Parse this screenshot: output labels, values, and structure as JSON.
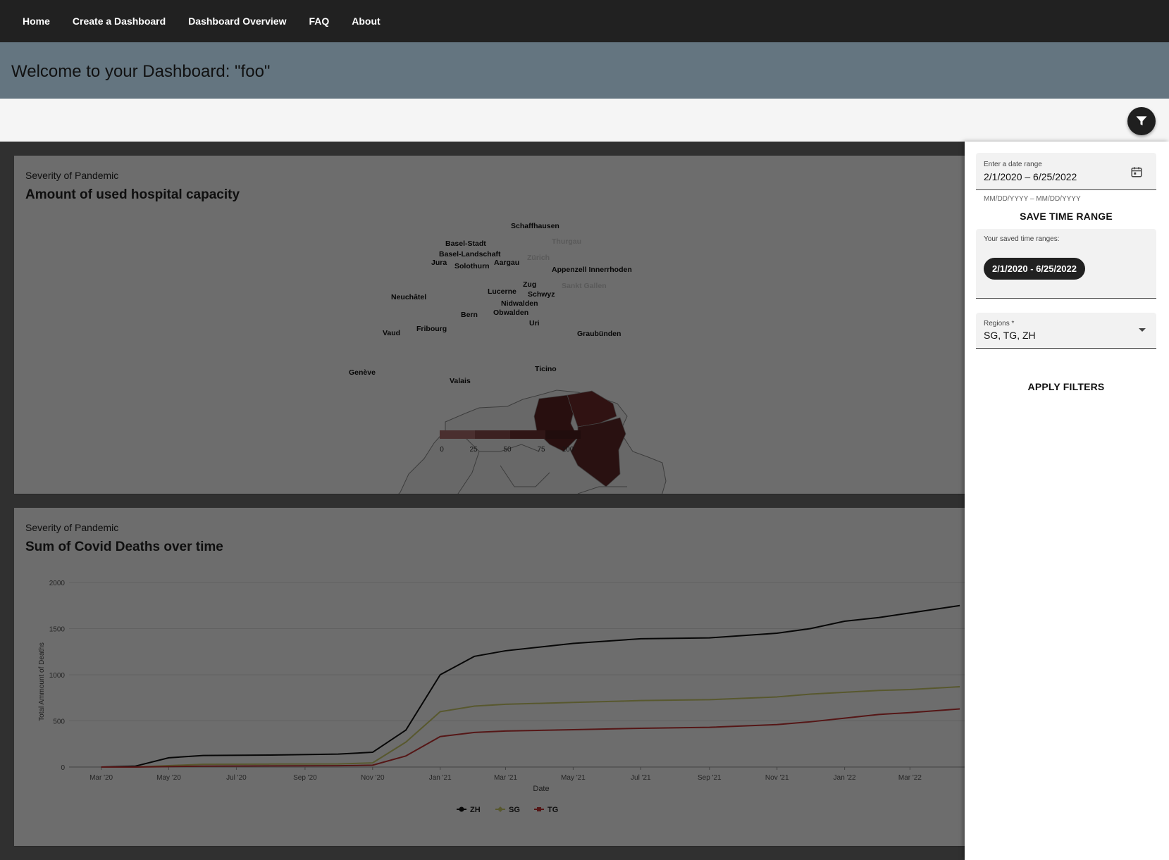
{
  "nav": {
    "items": [
      "Home",
      "Create a Dashboard",
      "Dashboard Overview",
      "FAQ",
      "About"
    ]
  },
  "header": {
    "title": "Welcome to your Dashboard: \"foo\""
  },
  "filter_button": {
    "icon": "filter-icon"
  },
  "map_card": {
    "subtitle": "Severity of Pandemic",
    "title": "Amount of used hospital capacity",
    "regions": [
      "Schaffhausen",
      "Thurgau",
      "Basel-Stadt",
      "Basel-Landschaft",
      "Jura",
      "Solothurn",
      "Aargau",
      "Zürich",
      "Appenzell Innerrhoden",
      "Neuchâtel",
      "Zug",
      "Lucerne",
      "Schwyz",
      "Sankt Gallen",
      "Nidwalden",
      "Obwalden",
      "Bern",
      "Uri",
      "Vaud",
      "Fribourg",
      "Graubünden",
      "Genève",
      "Ticino",
      "Valais"
    ],
    "highlighted_regions": [
      "Zürich",
      "Thurgau",
      "Sankt Gallen"
    ],
    "scale": {
      "ticks": [
        "0",
        "25",
        "50",
        "75",
        "100"
      ],
      "colors": [
        "#a86b6b",
        "#8a4b4b",
        "#6d3333",
        "#4c1f1f"
      ]
    }
  },
  "chart_card": {
    "subtitle": "Severity of Pandemic",
    "title": "Sum of Covid Deaths over time"
  },
  "chart_data": {
    "type": "line",
    "title": "Sum of Covid Deaths over time",
    "xlabel": "Date",
    "ylabel": "Total Ammount of Deaths",
    "ylim": [
      0,
      2000
    ],
    "yticks": [
      0,
      500,
      1000,
      1500,
      2000
    ],
    "xticks": [
      "Mar '20",
      "May '20",
      "Jul '20",
      "Sep '20",
      "Nov '20",
      "Jan '21",
      "Mar '21",
      "May '21",
      "Jul '21",
      "Sep '21",
      "Nov '21",
      "Jan '22",
      "Mar '22"
    ],
    "x": [
      "2020-03-01",
      "2020-04-01",
      "2020-05-01",
      "2020-06-01",
      "2020-08-01",
      "2020-10-01",
      "2020-11-01",
      "2020-12-01",
      "2021-01-01",
      "2021-02-01",
      "2021-03-01",
      "2021-05-01",
      "2021-07-01",
      "2021-09-01",
      "2021-11-01",
      "2021-12-01",
      "2022-01-01",
      "2022-02-01",
      "2022-03-01",
      "2022-04-15"
    ],
    "series": [
      {
        "name": "ZH",
        "color": "#111111",
        "marker": "circle",
        "values": [
          0,
          10,
          100,
          125,
          130,
          140,
          160,
          400,
          1000,
          1200,
          1260,
          1340,
          1390,
          1400,
          1450,
          1500,
          1580,
          1620,
          1670,
          1750
        ]
      },
      {
        "name": "SG",
        "color": "#c8c86a",
        "marker": "diamond",
        "values": [
          0,
          0,
          15,
          30,
          32,
          33,
          45,
          270,
          600,
          660,
          680,
          700,
          720,
          730,
          760,
          790,
          810,
          830,
          840,
          870
        ]
      },
      {
        "name": "TG",
        "color": "#c23434",
        "marker": "square",
        "values": [
          0,
          0,
          5,
          10,
          12,
          14,
          20,
          120,
          330,
          375,
          390,
          405,
          420,
          430,
          460,
          490,
          530,
          570,
          590,
          630
        ]
      }
    ],
    "legend_position": "bottom",
    "grid": true
  },
  "sidepanel": {
    "date_label": "Enter a date range",
    "date_value": "2/1/2020 – 6/25/2022",
    "date_hint": "MM/DD/YYYY – MM/DD/YYYY",
    "save_label": "SAVE TIME RANGE",
    "saved_label": "Your saved time ranges:",
    "saved_chip": "2/1/2020 - 6/25/2022",
    "regions_label": "Regions *",
    "regions_value": "SG, TG, ZH",
    "apply_label": "APPLY FILTERS"
  }
}
